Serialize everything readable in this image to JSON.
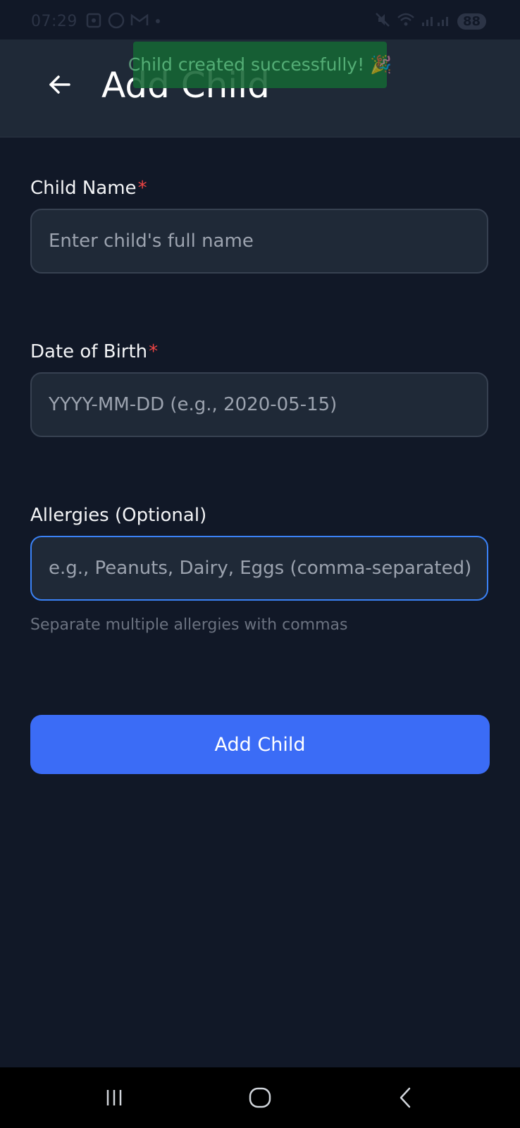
{
  "status_bar": {
    "time": "07:29",
    "battery": "88"
  },
  "header": {
    "title": "Add Child"
  },
  "toast": {
    "message": "Child created successfully! 🎉"
  },
  "form": {
    "name": {
      "label": "Child Name",
      "required_mark": "*",
      "placeholder": "Enter child's full name",
      "value": ""
    },
    "dob": {
      "label": "Date of Birth",
      "required_mark": "*",
      "placeholder": "YYYY-MM-DD (e.g., 2020-05-15)",
      "value": ""
    },
    "allergies": {
      "label": "Allergies (Optional)",
      "placeholder": "e.g., Peanuts, Dairy, Eggs (comma-separated)",
      "value": "",
      "helper": "Separate multiple allergies with commas"
    },
    "submit_label": "Add Child"
  },
  "colors": {
    "background": "#111827",
    "header": "#1f2937",
    "accent": "#3b6cf6",
    "focus_border": "#3b82f6",
    "required": "#ef4444",
    "toast": "#166534"
  },
  "icons": {
    "back": "arrow-left-icon",
    "nav_recents": "recents-icon",
    "nav_home": "home-icon",
    "nav_back": "nav-back-icon"
  }
}
